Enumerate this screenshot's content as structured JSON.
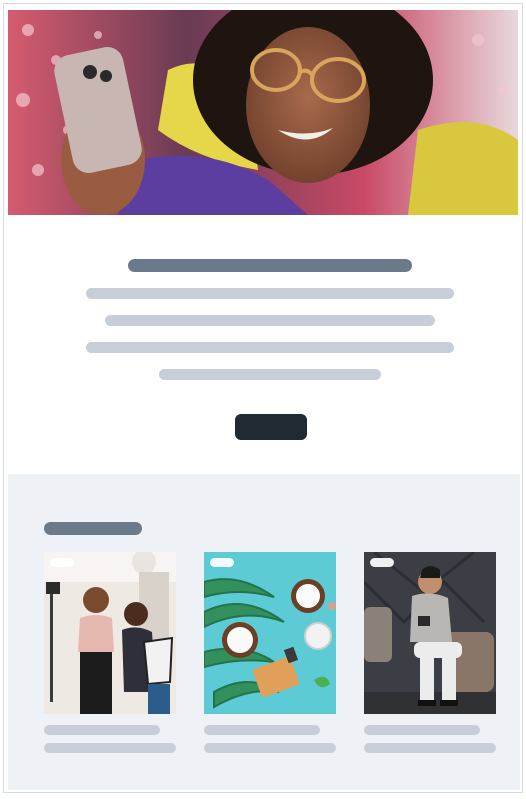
{
  "colors": {
    "placeholder_dark": "#6b7a8b",
    "placeholder_light": "#c8ced8",
    "button": "#1f2a33",
    "section_bg": "#eef2f6"
  },
  "hero": {
    "image": "woman-with-glasses-smiling-holding-phone"
  },
  "gallery": {
    "cards": [
      {
        "image": "two-women-filming-clothing-video"
      },
      {
        "image": "coconut-skincare-products-on-teal"
      },
      {
        "image": "man-seated-using-phone"
      }
    ]
  }
}
